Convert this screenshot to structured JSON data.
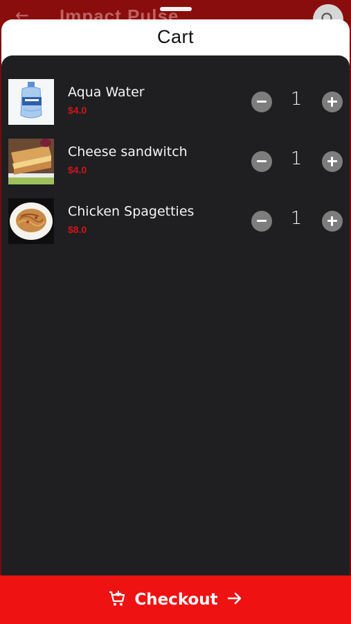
{
  "background": {
    "title": "Impact Pulse",
    "back_icon": "arrow-left-icon",
    "search_icon": "search-icon"
  },
  "sheet": {
    "title": "Cart"
  },
  "cart": {
    "items": [
      {
        "name": "Aqua Water",
        "price": "$4.0",
        "quantity": "1",
        "image": "water-jug-image"
      },
      {
        "name": "Cheese sandwitch",
        "price": "$4.0",
        "quantity": "1",
        "image": "sandwich-image"
      },
      {
        "name": "Chicken Spagetties",
        "price": "$8.0",
        "quantity": "1",
        "image": "spaghetti-image"
      }
    ]
  },
  "checkout": {
    "label": "Checkout",
    "cart_icon": "cart-add-icon",
    "arrow_icon": "arrow-right-icon"
  },
  "colors": {
    "accent": "#ee1212",
    "price": "#d0141a",
    "panel": "#1f1f21"
  }
}
